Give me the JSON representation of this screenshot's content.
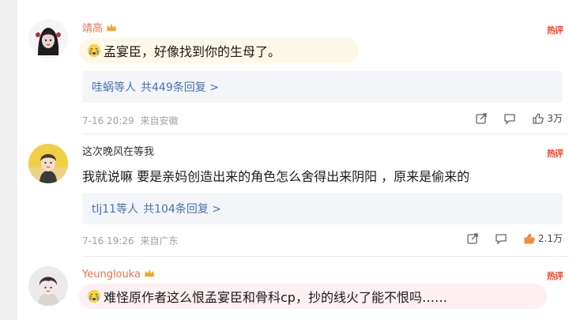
{
  "comments": [
    {
      "username": "靖高",
      "text": "孟宴臣，好像找到你的生母了。",
      "hot_label": "热评",
      "reply_user": "哇蜗等人",
      "reply_count": "共449条回复 >",
      "time": "7-16 20:29",
      "location": "来自安徽",
      "likes": "3万"
    },
    {
      "username": "这次晚风在等我",
      "text": "我就说嘛 要是亲妈创造出来的角色怎么舍得出来阴阳 ，原来是偷来的",
      "hot_label": "热评",
      "reply_user": "tlj11等人",
      "reply_count": "共104条回复 >",
      "time": "7-16 19:26",
      "location": "来自广东",
      "likes": "2.1万"
    },
    {
      "username": "Yeunglouka",
      "text": "难怪原作者这么恨孟宴臣和骨科cp，抄的线火了能不恨吗……",
      "hot_label": "热评"
    }
  ],
  "colors": {
    "vip_name": "#eb7350",
    "link": "#4672b3",
    "hot": "#ff3b1f",
    "liked": "#f28b3c"
  },
  "icons": [
    "crying-emoji-icon",
    "crown-icon",
    "share-icon",
    "comment-icon",
    "like-icon"
  ]
}
